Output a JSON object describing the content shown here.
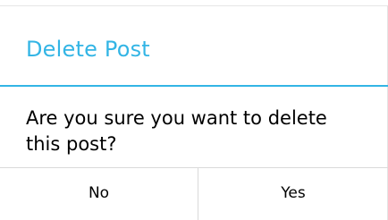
{
  "dialog": {
    "title": "Delete Post",
    "message": "Are you sure you want to delete this post?",
    "buttons": {
      "negative_label": "No",
      "positive_label": "Yes"
    }
  },
  "colors": {
    "accent": "#33b5e5",
    "divider": "#dadada",
    "text": "#000000",
    "background": "#ffffff"
  }
}
